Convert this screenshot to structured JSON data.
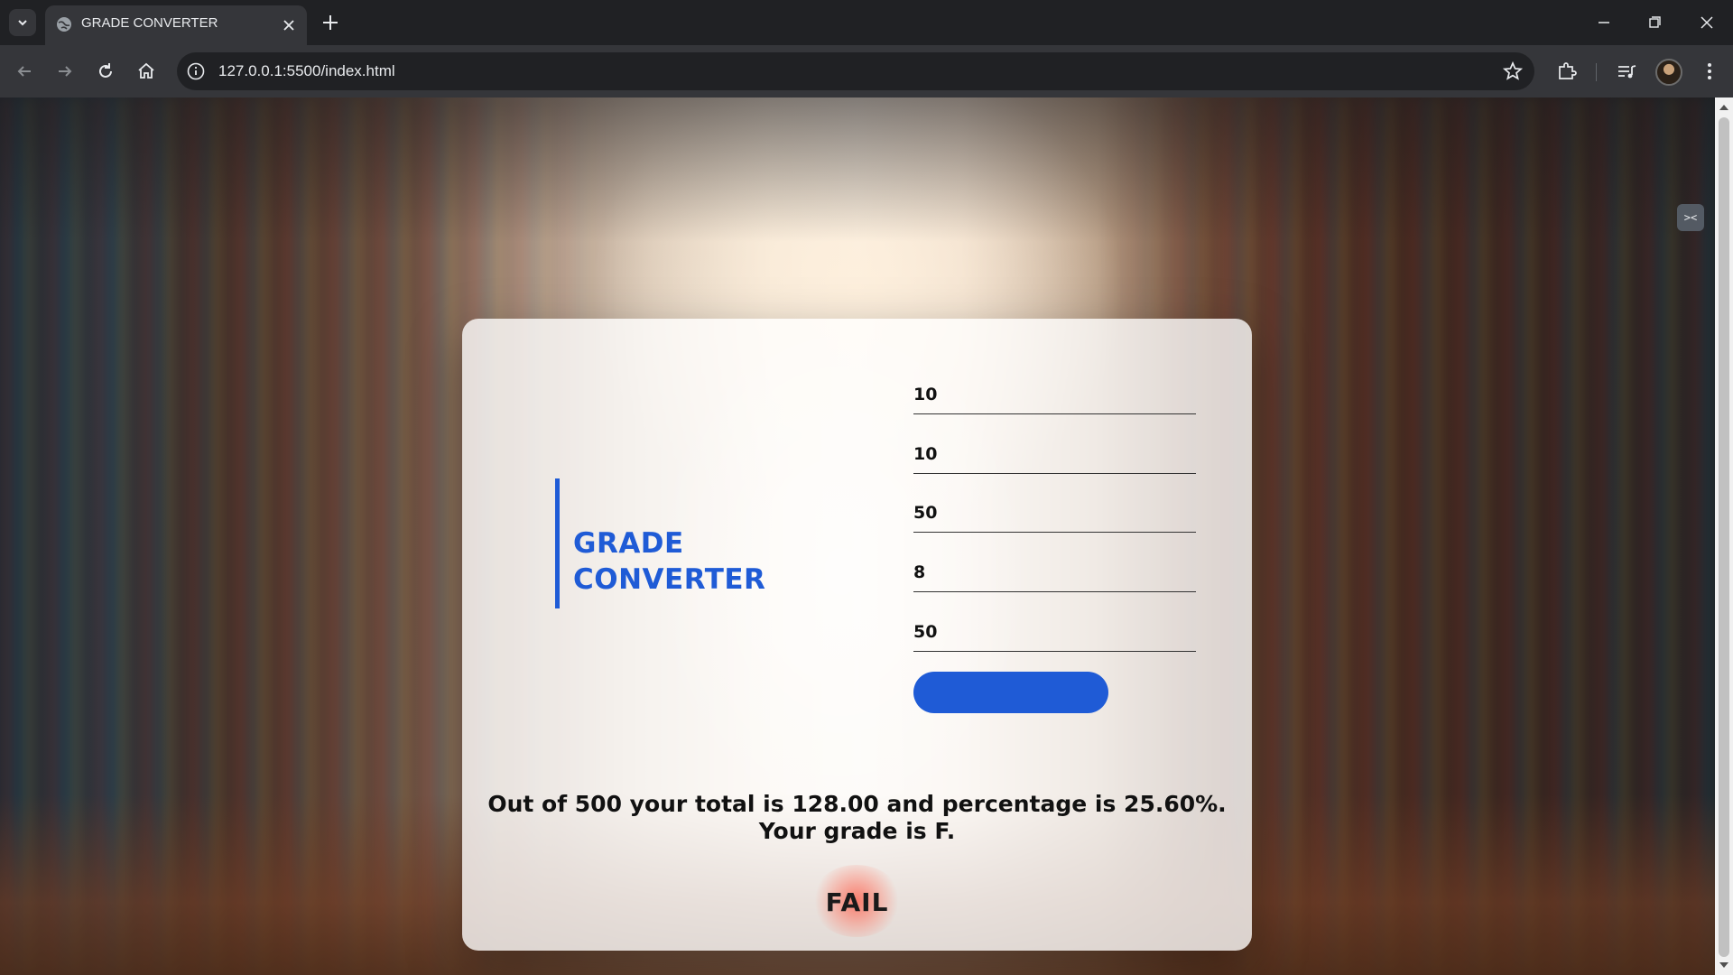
{
  "browser": {
    "tab_title": "GRADE CONVERTER",
    "url": "127.0.0.1:5500/index.html"
  },
  "icons": {
    "tab_search": "chevron-down-icon",
    "favicon": "globe-icon",
    "tab_close": "close-icon",
    "new_tab": "plus-icon",
    "back": "arrow-left-icon",
    "forward": "arrow-right-icon",
    "reload": "reload-icon",
    "home": "home-icon",
    "site_info": "info-icon",
    "bookmark": "star-icon",
    "extensions": "puzzle-icon",
    "media": "media-queue-icon",
    "menu": "kebab-menu-icon"
  },
  "extension_widget": {
    "glyph": "><"
  },
  "app": {
    "title_line1": "GRADE",
    "title_line2": "CONVERTER",
    "marks": [
      {
        "value": "10"
      },
      {
        "value": "10"
      },
      {
        "value": "50"
      },
      {
        "value": "8"
      },
      {
        "value": "50"
      }
    ],
    "submit_label": "",
    "result_line1": "Out of 500 your total is 128.00 and percentage is 25.60%.",
    "result_line2": "Your grade is F.",
    "status": "FAIL"
  },
  "colors": {
    "accent": "#1f5bd6",
    "fail_glow": "#ff5a46"
  }
}
